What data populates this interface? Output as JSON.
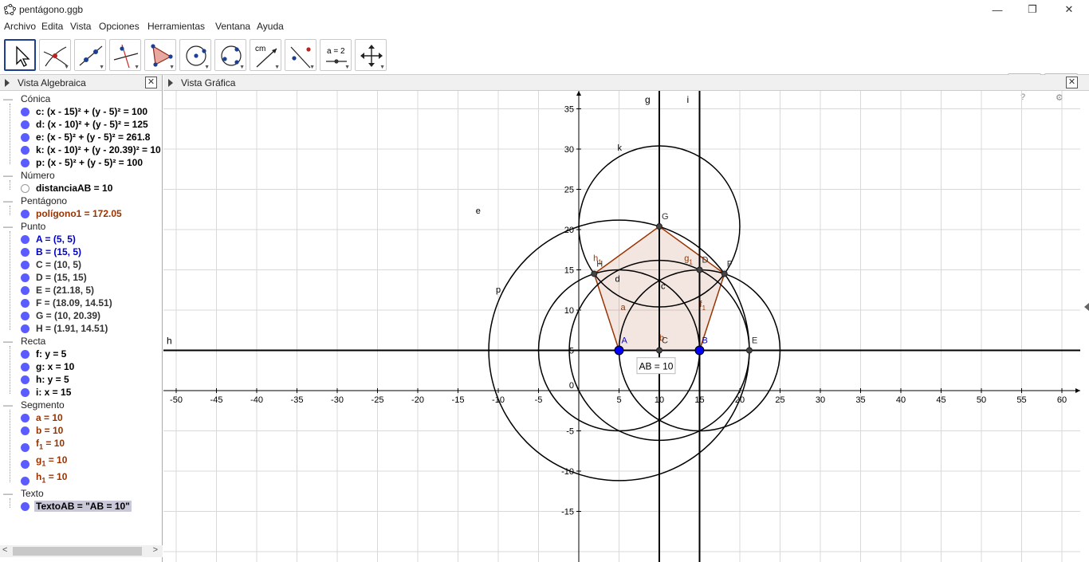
{
  "window": {
    "title": "pentágono.ggb",
    "minimize": "—",
    "maximize": "❐",
    "close": "✕"
  },
  "menu": [
    "Archivo",
    "Edita",
    "Vista",
    "Opciones",
    "Herramientas",
    "Ventana",
    "Ayuda"
  ],
  "toolbar": {
    "tools": [
      {
        "name": "move-tool",
        "icon": "cursor-arrow-icon",
        "active": true
      },
      {
        "name": "point-tool",
        "icon": "intersection-point-icon"
      },
      {
        "name": "line-tool",
        "icon": "line-through-points-icon"
      },
      {
        "name": "perpendicular-tool",
        "icon": "perpendicular-line-icon"
      },
      {
        "name": "polygon-tool",
        "icon": "polygon-icon"
      },
      {
        "name": "circle-tool",
        "icon": "circle-center-point-icon"
      },
      {
        "name": "circle-three-points-tool",
        "icon": "circle-three-points-icon"
      },
      {
        "name": "measure-tool",
        "icon": "distance-cm-icon"
      },
      {
        "name": "reflect-tool",
        "icon": "reflect-line-icon"
      },
      {
        "name": "slider-tool",
        "icon": "slider-icon"
      },
      {
        "name": "move-view-tool",
        "icon": "move-graphics-view-icon"
      }
    ],
    "cm_label": "cm",
    "slider_label": "a = 2",
    "undo": "⟲",
    "redo": "⟳",
    "help": "?",
    "settings": "⚙"
  },
  "algebra": {
    "title": "Vista Algebraica",
    "close": "✕",
    "categories": [
      {
        "label": "Cónica",
        "items": [
          {
            "text": "c: (x - 15)² + (y - 5)² = 100",
            "color": "#000000"
          },
          {
            "text": "d: (x - 10)² + (y - 5)² = 125",
            "color": "#000000"
          },
          {
            "text": "e: (x - 5)² + (y - 5)² = 261.8",
            "color": "#000000"
          },
          {
            "text": "k: (x - 10)² + (y - 20.39)² = 10",
            "color": "#000000"
          },
          {
            "text": "p: (x - 5)² + (y - 5)² = 100",
            "color": "#000000"
          }
        ]
      },
      {
        "label": "Número",
        "items": [
          {
            "text": "distanciaAB = 10",
            "color": "#000000",
            "hollow": true
          }
        ]
      },
      {
        "label": "Pentágono",
        "items": [
          {
            "text": "polígono1 = 172.05",
            "color": "#993300"
          }
        ]
      },
      {
        "label": "Punto",
        "items": [
          {
            "text": "A = (5, 5)",
            "color": "#0000cc"
          },
          {
            "text": "B = (15, 5)",
            "color": "#0000cc"
          },
          {
            "text": "C = (10, 5)",
            "color": "#333333"
          },
          {
            "text": "D = (15, 15)",
            "color": "#333333"
          },
          {
            "text": "E = (21.18, 5)",
            "color": "#333333"
          },
          {
            "text": "F = (18.09, 14.51)",
            "color": "#333333"
          },
          {
            "text": "G = (10, 20.39)",
            "color": "#333333"
          },
          {
            "text": "H = (1.91, 14.51)",
            "color": "#333333"
          }
        ]
      },
      {
        "label": "Recta",
        "items": [
          {
            "text": "f: y = 5",
            "color": "#000000"
          },
          {
            "text": "g: x = 10",
            "color": "#000000"
          },
          {
            "text": "h: y = 5",
            "color": "#000000"
          },
          {
            "text": "i: x = 15",
            "color": "#000000"
          }
        ]
      },
      {
        "label": "Segmento",
        "items": [
          {
            "text": "a = 10",
            "color": "#993300"
          },
          {
            "text": "b = 10",
            "color": "#993300"
          },
          {
            "text": "f",
            "sub": "1",
            "rest": " = 10",
            "color": "#993300"
          },
          {
            "text": "g",
            "sub": "1",
            "rest": " = 10",
            "color": "#993300"
          },
          {
            "text": "h",
            "sub": "1",
            "rest": " = 10",
            "color": "#993300"
          }
        ]
      },
      {
        "label": "Texto",
        "items": [
          {
            "text": "TextoAB = \"AB = 10\"",
            "color": "#000000",
            "selected": true
          }
        ]
      }
    ]
  },
  "graphics": {
    "title": "Vista Gráfica",
    "close": "✕",
    "x_ticks": [
      -50,
      -45,
      -40,
      -35,
      -30,
      -25,
      -20,
      -15,
      -10,
      -5,
      5,
      10,
      15,
      20,
      25,
      30,
      35,
      40,
      45,
      50,
      55,
      60
    ],
    "y_ticks": [
      -15,
      -10,
      -5,
      5,
      10,
      15,
      20,
      25,
      30,
      35
    ],
    "origin_label": "0",
    "lines": [
      {
        "name": "f",
        "type": "horizontal",
        "value": 5,
        "label": "h"
      },
      {
        "name": "g",
        "type": "vertical",
        "value": 10,
        "label": "g"
      },
      {
        "name": "i",
        "type": "vertical",
        "value": 15,
        "label": "i"
      }
    ],
    "circles": [
      {
        "name": "c",
        "cx": 15,
        "cy": 5,
        "r": 10,
        "label": "c"
      },
      {
        "name": "d",
        "cx": 10,
        "cy": 5,
        "r": 11.18,
        "label": "d"
      },
      {
        "name": "e",
        "cx": 5,
        "cy": 5,
        "r": 16.18,
        "label": "e"
      },
      {
        "name": "k",
        "cx": 10,
        "cy": 20.39,
        "r": 10,
        "label": "k"
      },
      {
        "name": "p",
        "cx": 5,
        "cy": 5,
        "r": 10,
        "label": "p"
      }
    ],
    "pentagon": [
      [
        5,
        5
      ],
      [
        15,
        5
      ],
      [
        18.09,
        14.51
      ],
      [
        10,
        20.39
      ],
      [
        1.91,
        14.51
      ]
    ],
    "segment_labels": [
      {
        "text": "a",
        "x": 5.2,
        "y": 10
      },
      {
        "text": "b",
        "x": 10,
        "y": 6.2
      },
      {
        "text": "f",
        "sub": "1",
        "x": 15,
        "y": 10.4
      },
      {
        "text": "g",
        "sub": "1",
        "x": 13.1,
        "y": 16.1
      },
      {
        "text": "h",
        "sub": "1",
        "x": 1.8,
        "y": 16.1
      }
    ],
    "points": [
      {
        "name": "A",
        "x": 5,
        "y": 5,
        "big": true,
        "color": "#0000ff",
        "labelColor": "#0000cc"
      },
      {
        "name": "B",
        "x": 15,
        "y": 5,
        "big": true,
        "color": "#0000ff",
        "labelColor": "#0000cc"
      },
      {
        "name": "C",
        "x": 10,
        "y": 5,
        "color": "#444444",
        "labelColor": "#333333"
      },
      {
        "name": "D",
        "x": 15,
        "y": 15,
        "color": "#444444",
        "labelColor": "#333333"
      },
      {
        "name": "E",
        "x": 21.18,
        "y": 5,
        "color": "#444444",
        "labelColor": "#333333"
      },
      {
        "name": "F",
        "x": 18.09,
        "y": 14.51,
        "color": "#444444",
        "labelColor": "#333333"
      },
      {
        "name": "G",
        "x": 10,
        "y": 20.39,
        "color": "#444444",
        "labelColor": "#333333"
      },
      {
        "name": "H",
        "x": 1.91,
        "y": 14.51,
        "color": "#444444",
        "labelColor": "#333333"
      }
    ],
    "textbox": {
      "text": "AB = 10",
      "x": 9.7,
      "y": 3
    }
  }
}
